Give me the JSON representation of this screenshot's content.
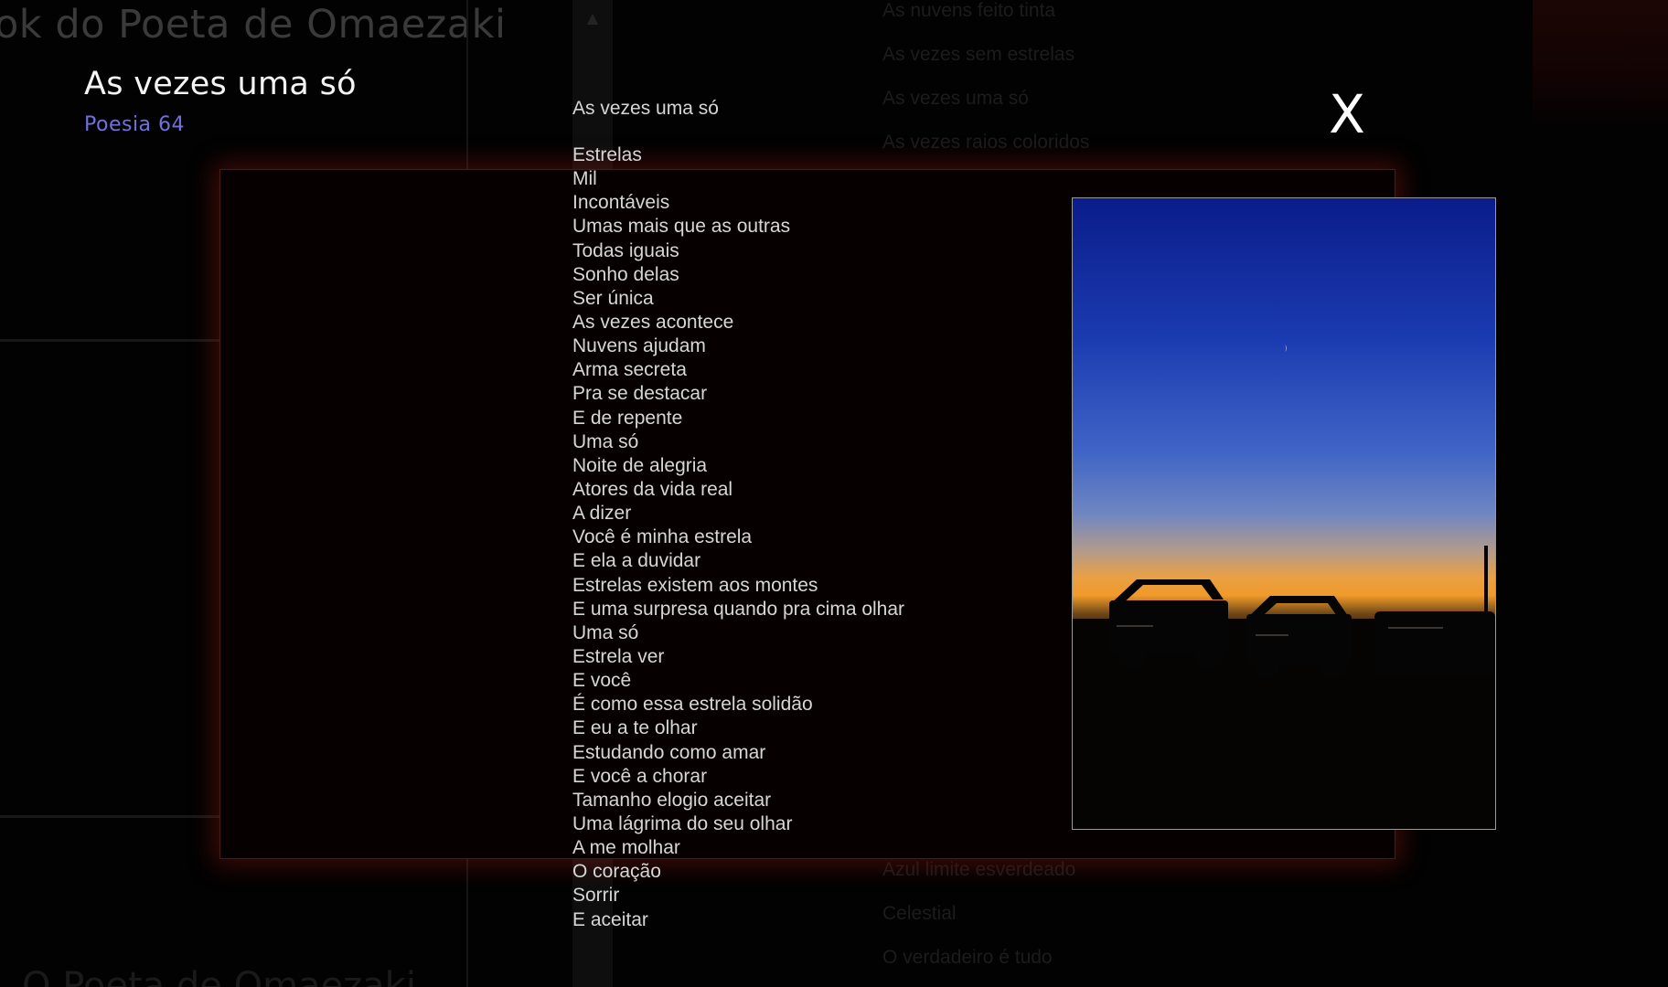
{
  "background": {
    "site_title": "ok do Poeta de Omaezaki",
    "list_top": [
      "As nuvens feito tinta",
      "As vezes sem estrelas",
      "As vezes uma só",
      "As vezes raios coloridos"
    ],
    "list_bottom": [
      "Azul limite esverdeado",
      "Celestial",
      "O verdadeiro é tudo"
    ],
    "bottom_title": "O Poeta de Omaezaki",
    "scroll_up_glyph": "▲"
  },
  "modal": {
    "title": "As vezes uma só",
    "subtitle": "Poesia 64",
    "close_label": "X"
  },
  "poem": {
    "heading": "As vezes uma só",
    "lines": [
      "Estrelas",
      "Mil",
      "Incontáveis",
      "Umas mais que as outras",
      "Todas iguais",
      "Sonho delas",
      "Ser única",
      "As vezes acontece",
      "Nuvens ajudam",
      "Arma secreta",
      "Pra se destacar",
      "E de repente",
      "Uma só",
      "Noite de alegria",
      "Atores da vida real",
      "A dizer",
      "Você é minha estrela",
      "E ela a duvidar",
      "Estrelas existem aos montes",
      "E uma surpresa quando pra cima olhar",
      "Uma só",
      "Estrela ver",
      "E você",
      "É como essa estrela solidão",
      "E eu a te olhar",
      "Estudando como amar",
      "E você a chorar",
      "Tamanho elogio aceitar",
      "Uma lágrima do seu olhar",
      "A me molhar",
      "O coração",
      "Sorrir",
      "E aceitar"
    ]
  },
  "photo": {
    "icon": "twilight-sky-photo"
  },
  "colors": {
    "accent_subtitle": "#7270dc",
    "panel_glow": "#8c1810",
    "text": "#d6d6d6"
  }
}
